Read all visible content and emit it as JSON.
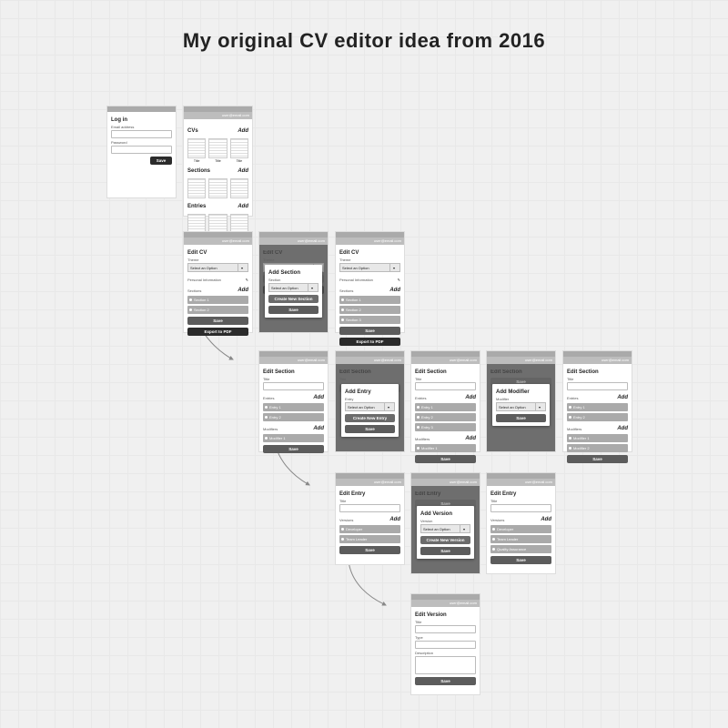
{
  "title": "My original CV editor idea from 2016",
  "user_email": "user@email.com",
  "add_label": "Add",
  "select_placeholder": "Select an Option",
  "btn": {
    "save": "Save",
    "export": "Export to PDF"
  },
  "login": {
    "heading": "Log in",
    "email_label": "Email address",
    "password_label": "Password"
  },
  "home": {
    "cvs_heading": "CVs",
    "sections_heading": "Sections",
    "entries_heading": "Entries",
    "tile_caption": "Title"
  },
  "edit_cv": {
    "heading": "Edit CV",
    "theme_label": "Theme",
    "pi_label": "Personal Information",
    "sections_label": "Sections",
    "items_2": [
      "Section 1",
      "Section 2"
    ],
    "items_3": [
      "Section 1",
      "Section 2",
      "Section 3"
    ],
    "modal": {
      "heading": "Add Section",
      "label": "Section",
      "btn": "Create New Section"
    }
  },
  "edit_section": {
    "heading": "Edit Section",
    "title_label": "Title",
    "entries_label": "Entries",
    "modifiers_label": "Modifiers",
    "entries_2": [
      "Entry 1",
      "Entry 2"
    ],
    "entries_3": [
      "Entry 1",
      "Entry 2",
      "Entry 3"
    ],
    "mod_1": [
      "Modifier 1"
    ],
    "mod_2": [
      "Modifier 1",
      "Modifier 2"
    ],
    "add_entry": {
      "heading": "Add Entry",
      "label": "Entry",
      "btn": "Create New Entry"
    },
    "add_mod": {
      "heading": "Add Modifier",
      "label": "Modifier"
    }
  },
  "edit_entry": {
    "heading": "Edit Entry",
    "title_label": "Title",
    "versions_label": "Versions",
    "versions_2": [
      "Developer",
      "Team Leader"
    ],
    "versions_3": [
      "Developer",
      "Team Leader",
      "Quality Assurance"
    ],
    "add_ver": {
      "heading": "Add Version",
      "label": "Version",
      "btn": "Create New Version"
    }
  },
  "edit_version": {
    "heading": "Edit Version",
    "title_label": "Title",
    "type_label": "Type",
    "desc_label": "Description"
  }
}
